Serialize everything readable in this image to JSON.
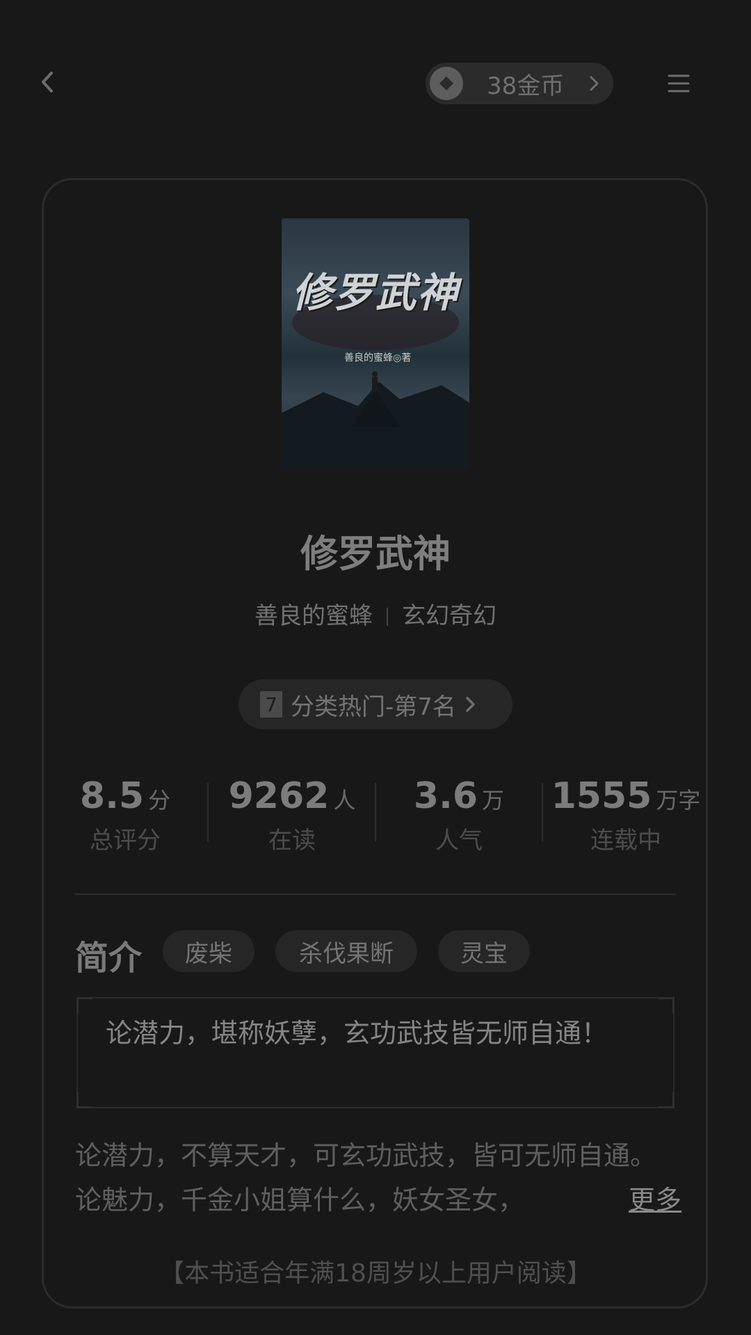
{
  "header": {
    "coins": "38金币",
    "icons": {
      "back": "chevron-left-icon",
      "coin": "coin-icon",
      "menu": "menu-icon"
    }
  },
  "book": {
    "cover_title": "修罗武神",
    "cover_author": "善良的蜜蜂◎著",
    "title": "修罗武神",
    "author": "善良的蜜蜂",
    "category": "玄幻奇幻",
    "rank_badge": "7",
    "rank_text": "分类热门-第7名"
  },
  "stats": [
    {
      "value": "8.5",
      "unit": "分",
      "label": "总评分"
    },
    {
      "value": "9262",
      "unit": "人",
      "label": "在读"
    },
    {
      "value": "3.6",
      "unit": "万",
      "label": "人气"
    },
    {
      "value": "1555",
      "unit": "万字",
      "label": "连载中"
    }
  ],
  "intro": {
    "title": "简介",
    "tags": [
      "废柴",
      "杀伐果断",
      "灵宝"
    ],
    "quote": "论潜力，堪称妖孽，玄功武技皆无师自通！",
    "description": "论潜力，不算天才，可玄功武技，皆可无师自通。论魅力，千金小姐算什么，妖女圣女，",
    "more_label": "更多"
  },
  "notice": "【本书适合年满18周岁以上用户阅读】"
}
